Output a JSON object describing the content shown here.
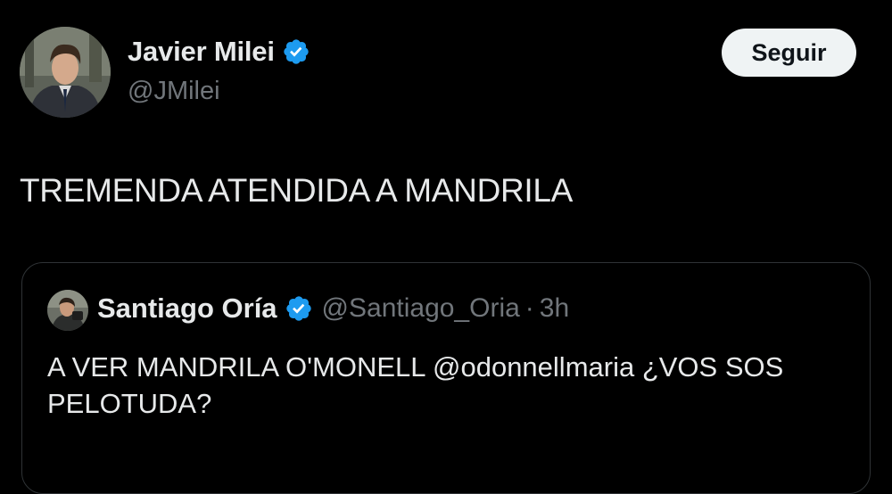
{
  "post": {
    "author_name": "Javier Milei",
    "author_handle": "@JMilei",
    "verified_icon": "verified-badge-icon",
    "follow_label": "Seguir",
    "text": "TREMENDA ATENDIDA A MANDRILA"
  },
  "quoted_post": {
    "author_name": "Santiago Oría",
    "author_handle": "@Santiago_Oria",
    "separator": "·",
    "time": "3h",
    "verified_icon": "verified-badge-icon",
    "text": "A VER MANDRILA O'MONELL @odonnellmaria ¿VOS SOS PELOTUDA?"
  },
  "colors": {
    "background": "#000000",
    "primary_text": "#e7e9ea",
    "secondary_text": "#71767b",
    "verified_blue": "#1d9bf0",
    "button_bg": "#eff3f4",
    "button_text": "#0f1419",
    "border": "#2f3336"
  }
}
